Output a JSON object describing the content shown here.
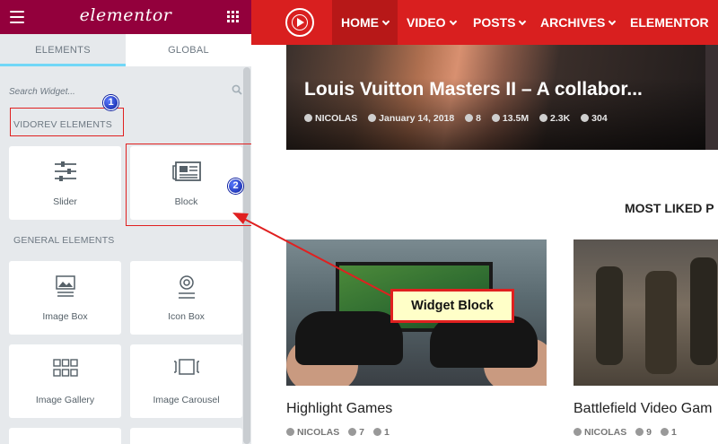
{
  "panel": {
    "logo": "elementor",
    "tabs": [
      "ELEMENTS",
      "GLOBAL"
    ],
    "search_placeholder": "Search Widget...",
    "vidorev_title": "VIDOREV ELEMENTS",
    "general_title": "GENERAL ELEMENTS",
    "vidorev_widgets": [
      {
        "label": "Slider",
        "icon": "sliders-icon"
      },
      {
        "label": "Block",
        "icon": "newspaper-icon"
      }
    ],
    "general_widgets": [
      {
        "label": "Image Box",
        "icon": "image-box-icon"
      },
      {
        "label": "Icon Box",
        "icon": "icon-box-icon"
      },
      {
        "label": "Image Gallery",
        "icon": "gallery-grid-icon"
      },
      {
        "label": "Image Carousel",
        "icon": "carousel-icon"
      }
    ],
    "header_color": "#93003c"
  },
  "annotations": {
    "marker1": "1",
    "marker2": "2",
    "callout": "Widget Block",
    "color": "#e02020"
  },
  "site": {
    "nav": [
      {
        "label": "HOME"
      },
      {
        "label": "VIDEO"
      },
      {
        "label": "POSTS"
      },
      {
        "label": "ARCHIVES"
      },
      {
        "label": "ELEMENTOR"
      }
    ],
    "nav_color": "#d91f1f",
    "feature": {
      "title": "Louis Vuitton Masters II – A collabor...",
      "author": "NICOLAS",
      "date": "January 14, 2018",
      "comments": "8",
      "views": "13.5M",
      "likes": "2.3K",
      "dislikes": "304"
    },
    "section_title": "MOST LIKED P",
    "cards": [
      {
        "title": "Highlight Games",
        "author": "NICOLAS",
        "views": "7",
        "likes": "1"
      },
      {
        "title": "Battlefield Video Gam",
        "author": "NICOLAS",
        "views": "9",
        "likes": "1"
      }
    ]
  }
}
